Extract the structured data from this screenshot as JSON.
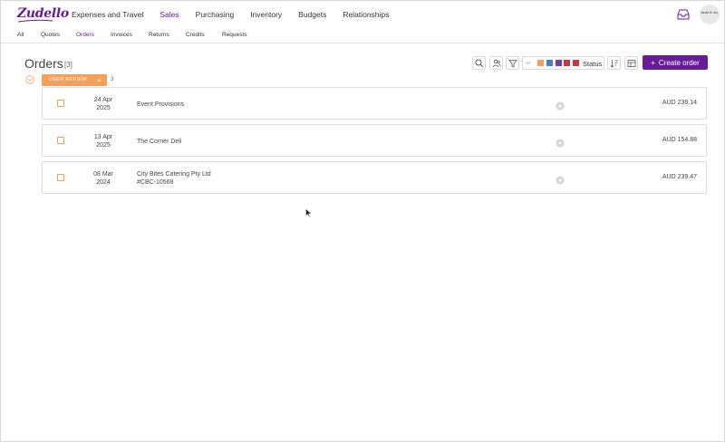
{
  "app": {
    "logo_text": "Zudello",
    "nav": [
      "Expenses and Travel",
      "Sales",
      "Purchasing",
      "Inventory",
      "Budgets",
      "Relationships"
    ],
    "nav_active": "Sales",
    "avatar_text": "Jamie B. Inc.",
    "accent": "#6a1b9a"
  },
  "subnav": {
    "items": [
      "All",
      "Quotes",
      "Orders",
      "Invoices",
      "Returns",
      "Credits",
      "Requests"
    ],
    "active": "Orders"
  },
  "page": {
    "title": "Orders",
    "count": "[3]"
  },
  "toolbar": {
    "status_zero": "0+",
    "status_label": "Status",
    "status_colors": [
      "#f5a05a",
      "#4a7fc1",
      "#7b3fa0",
      "#c0394b",
      "#c0394b"
    ],
    "create_label": "Create order",
    "icons": [
      "search-icon",
      "users-icon",
      "filter-icon",
      "sort-icon",
      "layout-icon"
    ]
  },
  "group": {
    "label": "USER REVIEW",
    "count": "3",
    "color": "#f5a05a"
  },
  "orders": [
    {
      "date_day": "24 Apr",
      "date_year": "2025",
      "name": "Event Provisions",
      "ref": "",
      "amount": "AUD 239.14"
    },
    {
      "date_day": "13 Apr",
      "date_year": "2025",
      "name": "The Corner Deli",
      "ref": "",
      "amount": "AUD 154.88"
    },
    {
      "date_day": "08 Mar",
      "date_year": "2024",
      "name": "City Bites Catering Pty Ltd",
      "ref": "#CBC-10568",
      "amount": "AUD 239.47"
    }
  ]
}
